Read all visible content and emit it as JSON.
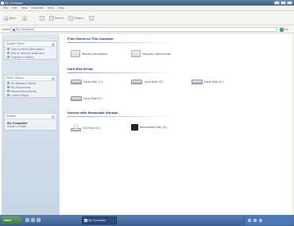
{
  "window": {
    "title": "My Computer",
    "controls": [
      "minimize",
      "maximize",
      "close"
    ]
  },
  "menubar": [
    "File",
    "Edit",
    "View",
    "Favorites",
    "Tools",
    "Help"
  ],
  "toolbar": {
    "back_label": "Back",
    "forward_label": "",
    "up_label": "",
    "search_label": "Search",
    "folders_label": "Folders",
    "views_label": ""
  },
  "address": {
    "label": "Address",
    "value": "My Computer",
    "go_label": "Go"
  },
  "sidebar": {
    "system_tasks": {
      "heading": "System Tasks",
      "items": [
        "View system information",
        "Add or remove programs",
        "Change a setting"
      ]
    },
    "other_places": {
      "heading": "Other Places",
      "items": [
        "My Network Places",
        "My Documents",
        "Shared Documents",
        "Control Panel"
      ]
    },
    "details": {
      "heading": "Details",
      "title": "My Computer",
      "subtitle": "System Folder"
    }
  },
  "main": {
    "groups": [
      {
        "heading": "Files Stored on This Computer",
        "items": [
          "Shared Documents",
          "Sample's Documents"
        ]
      },
      {
        "heading": "Hard Disk Drives",
        "items": [
          "Local Disk (C:)",
          "Local Disk (D:)",
          "Local Disk (E:)",
          "Local Disk (F:)"
        ]
      },
      {
        "heading": "Devices with Removable Storage",
        "items": [
          "CD Drive (G:)",
          "Removable Disk (H:)"
        ]
      }
    ]
  },
  "taskbar": {
    "start_label": "start",
    "window_button": "My Computer",
    "clock": ""
  },
  "colors": {
    "titlebar": "#3d5c82",
    "sidebar": "#c8d6e4",
    "taskbar": "#3c5f93",
    "start": "#3f7a3f",
    "group_heading": "#2a3f6a"
  }
}
